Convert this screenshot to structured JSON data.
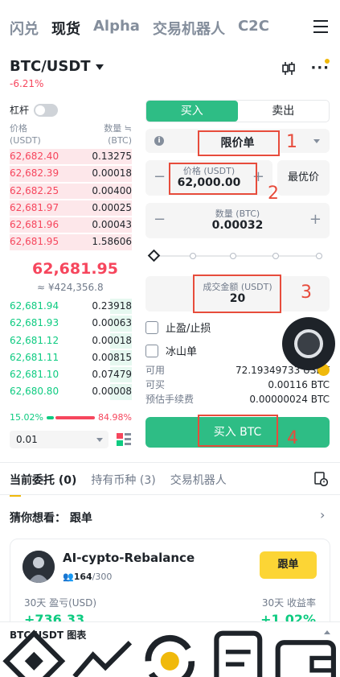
{
  "top_tabs": [
    "闪兑",
    "现货",
    "Alpha",
    "交易机器人",
    "C2C"
  ],
  "pair": "BTC/USDT",
  "change": "-6.21%",
  "leverage_label": "杠杆",
  "orderbook": {
    "price_header": "价格",
    "price_unit": "(USDT)",
    "qty_header": "数量 ≒",
    "qty_unit": "(BTC)",
    "asks": [
      {
        "price": "62,682.40",
        "qty": "0.13275",
        "depth": 1.0
      },
      {
        "price": "62,682.39",
        "qty": "0.00018",
        "depth": 1.0
      },
      {
        "price": "62,682.25",
        "qty": "0.00400",
        "depth": 1.0
      },
      {
        "price": "62,681.97",
        "qty": "0.00025",
        "depth": 1.0
      },
      {
        "price": "62,681.96",
        "qty": "0.00043",
        "depth": 1.0
      },
      {
        "price": "62,681.95",
        "qty": "1.58606",
        "depth": 1.0
      }
    ],
    "last_price": "62,681.95",
    "last_price_cny": "≈ ¥424,356.8",
    "bids": [
      {
        "price": "62,681.94",
        "qty": "0.23918",
        "depth": 0.18
      },
      {
        "price": "62,681.93",
        "qty": "0.00063",
        "depth": 0.18
      },
      {
        "price": "62,681.12",
        "qty": "0.00018",
        "depth": 0.18
      },
      {
        "price": "62,681.11",
        "qty": "0.00815",
        "depth": 0.18
      },
      {
        "price": "62,681.10",
        "qty": "0.07479",
        "depth": 0.18
      },
      {
        "price": "62,680.80",
        "qty": "0.00008",
        "depth": 0.18
      }
    ],
    "buy_ratio": "15.02%",
    "sell_ratio": "84.98%",
    "buy_ratio_value": 15.02,
    "precision": "0.01"
  },
  "form": {
    "buy_tab": "买入",
    "sell_tab": "卖出",
    "order_type": "限价单",
    "price_label": "价格 (USDT)",
    "price_value": "62,000.00",
    "best_price": "最优价",
    "qty_label": "数量 (BTC)",
    "qty_value": "0.00032",
    "total_label": "成交金额 (USDT)",
    "total_value": "20",
    "tpsl_label": "止盈/止损",
    "iceberg_label": "冰山单",
    "available_label": "可用",
    "available_value": "72.19349733 USDT",
    "can_buy_label": "可买",
    "can_buy_value": "0.00116 BTC",
    "fee_label": "预估手续费",
    "fee_value": "0.00000024 BTC",
    "submit": "买入 BTC"
  },
  "annotations": [
    "1",
    "2",
    "3",
    "4"
  ],
  "bottom_tabs": [
    "当前委托 (0)",
    "持有币种 (3)",
    "交易机器人"
  ],
  "guess": "猜你想看： 跟单",
  "bot_card": {
    "name": "AI-cypto-Rebalance",
    "users": "164",
    "users_total": "/300",
    "follow": "跟单",
    "pnl_label": "30天 盈亏(USD)",
    "roi_label": "30天 收益率",
    "pnl_value": "+736.33",
    "roi_value": "+1.02%"
  },
  "chart_bar": "BTC/USDT 图表",
  "colors": {
    "up": "#0ecb81",
    "down": "#f6465d",
    "brand": "#f0b90b",
    "buy": "#2ebd85"
  }
}
